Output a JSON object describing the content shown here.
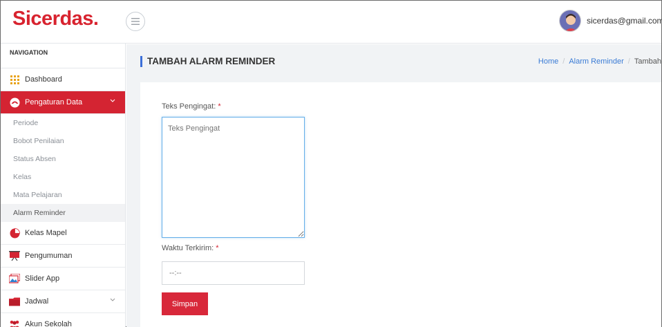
{
  "app": {
    "logo": "Sicerdas."
  },
  "user": {
    "email": "sicerdas@gmail.com"
  },
  "sidebar": {
    "heading": "NAVIGATION",
    "items": [
      {
        "label": "Dashboard",
        "icon": "grid-icon"
      },
      {
        "label": "Pengaturan Data",
        "icon": "gauge-icon",
        "active": true
      },
      {
        "label": "Kelas Mapel",
        "icon": "pie-chart-icon"
      },
      {
        "label": "Pengumuman",
        "icon": "presentation-board-icon"
      },
      {
        "label": "Slider App",
        "icon": "images-icon"
      },
      {
        "label": "Jadwal",
        "icon": "folder-icon"
      },
      {
        "label": "Akun Sekolah",
        "icon": "users-icon"
      }
    ],
    "subitems": [
      "Periode",
      "Bobot Penilaian",
      "Status Absen",
      "Kelas",
      "Mata Pelajaran",
      "Alarm Reminder"
    ]
  },
  "page": {
    "title": "TAMBAH ALARM REMINDER",
    "breadcrumb": [
      "Home",
      "Alarm Reminder",
      "Tambah"
    ]
  },
  "form": {
    "text_label": "Teks Pengingat:",
    "text_placeholder": "Teks Pengingat",
    "time_label": "Waktu Terkirim:",
    "time_value": "--:--",
    "required_mark": "*",
    "submit_label": "Simpan"
  },
  "colors": {
    "brand": "#d8232f",
    "accent": "#3b6fd8",
    "active_bg": "#d42432"
  }
}
